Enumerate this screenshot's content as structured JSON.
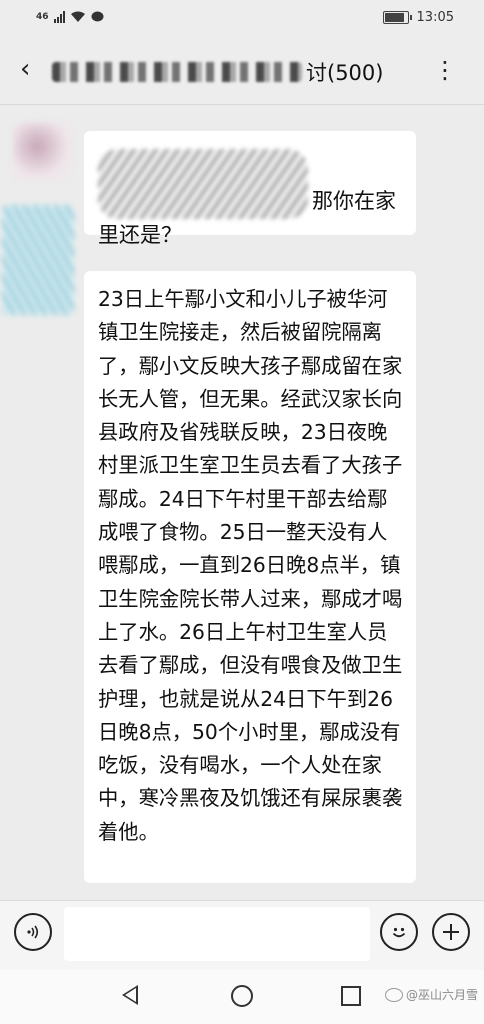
{
  "status_bar": {
    "signal_label": "46",
    "time": "13:05",
    "battery_level": 0.9
  },
  "header": {
    "title_suffix": "讨(500)",
    "more_label": "⋮",
    "back_label": "‹"
  },
  "messages": [
    {
      "type": "received",
      "text_line1": "那你在家",
      "text_line2": "里还是？"
    },
    {
      "type": "received",
      "text": "23日上午鄢小文和小儿子被华河镇卫生院接走，然后被留院隔离了，鄢小文反映大孩子鄢成留在家长无人管，但无果。经武汉家长向县政府及省残联反映，23日夜晚村里派卫生室卫生员去看了大孩子鄢成。24日下午村里干部去给鄢成喂了食物。25日一整天没有人喂鄢成，一直到26日晚8点半，镇卫生院金院长带人过来，鄢成才喝上了水。26日上午村卫生室人员去看了鄢成，但没有喂食及做卫生护理，也就是说从24日下午到26日晚8点，50个小时里，鄢成没有吃饭，没有喝水，一个人处在家中，寒冷黑夜及饥饿还有屎尿裹袭着他。"
    }
  ],
  "input_bar": {
    "voice_icon": "voice-icon",
    "emoji_icon": "emoji-icon",
    "plus_icon": "plus-icon",
    "input_placeholder": ""
  },
  "watermark": {
    "text": "@巫山六月雪"
  }
}
